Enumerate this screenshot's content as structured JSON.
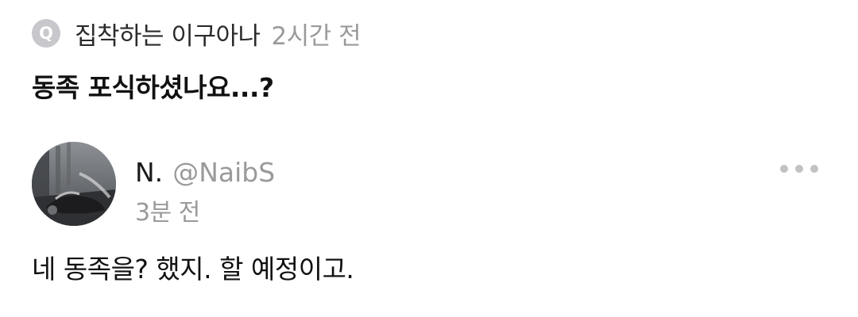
{
  "question": {
    "badge_letter": "Q",
    "asker": "집착하는 이구아나",
    "time": "2시간 전",
    "text": "동족 포식하셨나요...?"
  },
  "answer": {
    "avatar_icon": "profile-photo",
    "display_name": "N.",
    "handle": "@NaibS",
    "time": "3분 전",
    "more_icon": "more-horizontal-icon",
    "text": "네 동족을? 했지. 할 예정이고."
  },
  "colors": {
    "badge_bg": "#c7c7cc",
    "primary_text": "#111111",
    "secondary_text": "#9a9a9a"
  }
}
